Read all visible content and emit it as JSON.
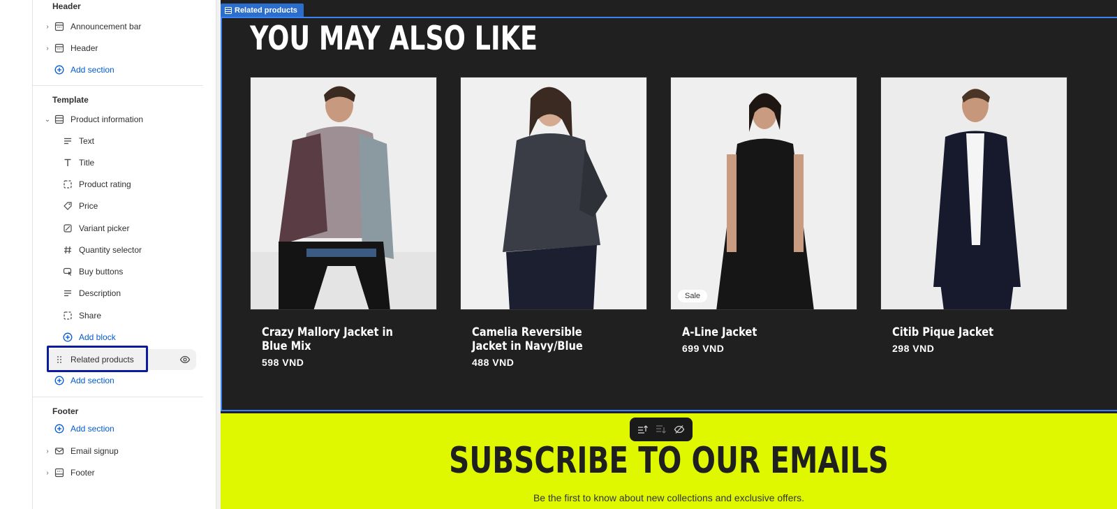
{
  "sidebar": {
    "header_group": "Header",
    "header_items": [
      {
        "label": "Announcement bar",
        "icon": "section-icon"
      },
      {
        "label": "Header",
        "icon": "section-icon"
      }
    ],
    "add_section_1": "Add section",
    "template_group": "Template",
    "product_information": "Product information",
    "blocks": [
      {
        "label": "Text",
        "icon": "text-lines-icon"
      },
      {
        "label": "Title",
        "icon": "title-t-icon"
      },
      {
        "label": "Product rating",
        "icon": "dashed-square-icon"
      },
      {
        "label": "Price",
        "icon": "price-tag-icon"
      },
      {
        "label": "Variant picker",
        "icon": "variant-icon"
      },
      {
        "label": "Quantity selector",
        "icon": "hash-icon"
      },
      {
        "label": "Buy buttons",
        "icon": "cursor-button-icon"
      },
      {
        "label": "Description",
        "icon": "text-lines-icon"
      },
      {
        "label": "Share",
        "icon": "dashed-square-icon"
      }
    ],
    "add_block": "Add block",
    "related_products": "Related products",
    "add_section_2": "Add section",
    "footer_group": "Footer",
    "add_section_3": "Add section",
    "footer_items": [
      {
        "label": "Email signup",
        "icon": "envelope-icon"
      },
      {
        "label": "Footer",
        "icon": "section-icon"
      }
    ]
  },
  "preview": {
    "section_tag": "Related products",
    "heading": "YOU MAY ALSO LIKE",
    "products": [
      {
        "name": "Crazy Mallory Jacket in Blue Mix",
        "price": "598 VND",
        "sale": ""
      },
      {
        "name": "Camelia Reversible Jacket in Navy/Blue",
        "price": "488 VND",
        "sale": ""
      },
      {
        "name": "A-Line Jacket",
        "price": "699 VND",
        "sale": "Sale"
      },
      {
        "name": "Citib Pique Jacket",
        "price": "298 VND",
        "sale": ""
      }
    ],
    "subscribe_heading": "SUBSCRIBE TO OUR EMAILS",
    "subscribe_text": "Be the first to know about new collections and exclusive offers."
  },
  "colors": {
    "accent": "#005bd3",
    "related_bg": "#202020",
    "subscribe_bg": "#dff800",
    "selection_outline": "#0b1b9e"
  }
}
